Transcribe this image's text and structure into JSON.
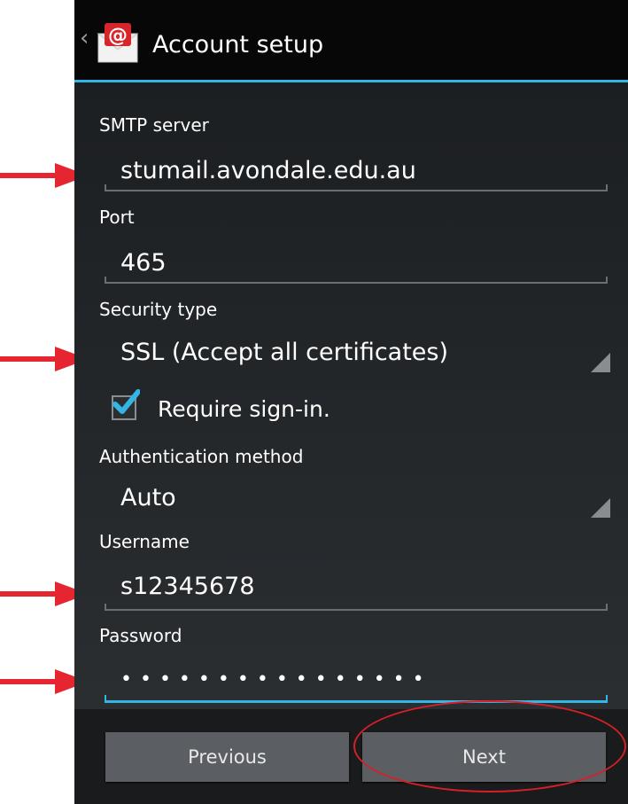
{
  "actionbar": {
    "title": "Account setup",
    "accent": "#33b5e5",
    "icon": "email-app-icon"
  },
  "form": {
    "smtp_label": "SMTP server",
    "smtp_value": "stumail.avondale.edu.au",
    "port_label": "Port",
    "port_value": "465",
    "security_label": "Security type",
    "security_value": "SSL (Accept all certificates)",
    "require_signin_label": "Require sign-in.",
    "require_signin_checked": true,
    "auth_label": "Authentication method",
    "auth_value": "Auto",
    "username_label": "Username",
    "username_value": "s12345678",
    "password_label": "Password",
    "password_value": "••••••••••••••••"
  },
  "buttons": {
    "previous": "Previous",
    "next": "Next"
  },
  "annotations": {
    "arrow_color": "#e52630",
    "highlight_color": "#d81f26"
  }
}
